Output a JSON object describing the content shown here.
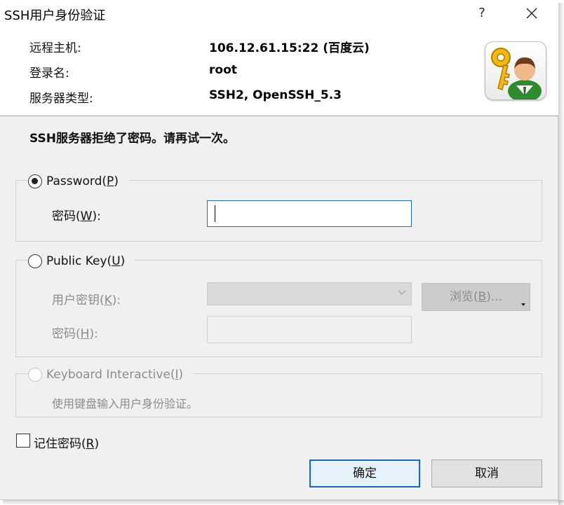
{
  "window": {
    "title": "SSH用户身份验证",
    "help_glyph": "?"
  },
  "header": {
    "rows": [
      {
        "label": "远程主机:",
        "value": "106.12.61.15:22 (百度云)"
      },
      {
        "label": "登录名:",
        "value": "root"
      },
      {
        "label": "服务器类型:",
        "value": "SSH2, OpenSSH_5.3"
      }
    ],
    "icon": "key-user-icon"
  },
  "message": "SSH服务器拒绝了密码。请再试一次。",
  "password_group": {
    "label": "Password",
    "accel": "P",
    "selected": true,
    "field_label": "密码",
    "field_accel": "W",
    "field_value": ""
  },
  "publickey_group": {
    "label": "Public Key",
    "accel": "U",
    "selected": false,
    "key_label": "用户密钥",
    "key_accel": "K",
    "key_value": "",
    "browse_label": "浏览",
    "browse_accel": "B",
    "browse_suffix": "...",
    "passphrase_label": "密码",
    "passphrase_accel": "H"
  },
  "keyboard_group": {
    "label": "Keyboard Interactive",
    "accel": "I",
    "selected": false,
    "hint": "使用键盘输入用户身份验证。"
  },
  "remember": {
    "label": "记住密码",
    "accel": "R",
    "checked": false
  },
  "buttons": {
    "ok": "确定",
    "cancel": "取消"
  },
  "colors": {
    "focus_border": "#1f6fc5",
    "default_button_border": "#0f66cc"
  }
}
